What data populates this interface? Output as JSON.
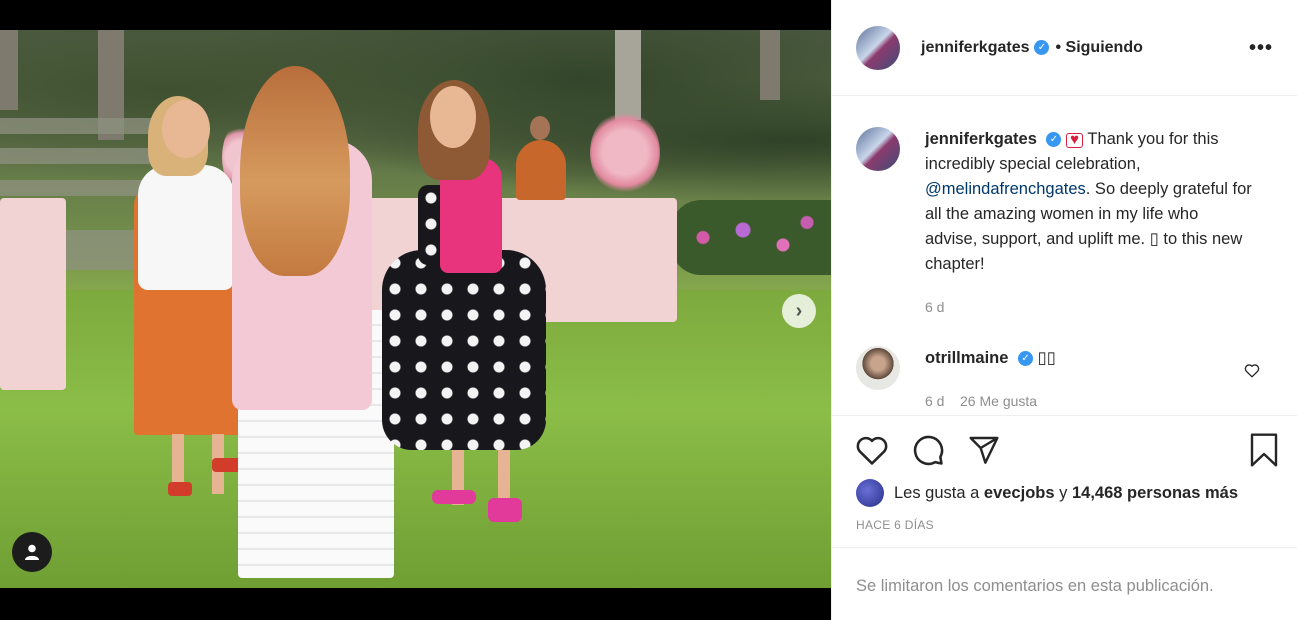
{
  "post": {
    "author": "jenniferkgates",
    "follow_status": "• Siguiendo",
    "more_label": "•••",
    "verified_mark": "✓"
  },
  "caption": {
    "user": "jenniferkgates",
    "text_before": " Thank you for this incredibly special celebration, ",
    "mention": "@melindafrenchgates",
    "text_after": ". So deeply grateful for all the amazing women in my life who advise, support, and uplift me. ▯ to this new chapter!",
    "time": "6 d"
  },
  "comment": {
    "user": "otrillmaine",
    "text": "▯▯",
    "meta": "6 d    26 Me gusta"
  },
  "likes": {
    "prefix": "Les gusta a ",
    "user": "evecjobs",
    "middle": " y ",
    "count": "14,468 personas más"
  },
  "date": "HACE 6 DÍAS",
  "comments_limited": "Se limitaron los comentarios en esta publicación.",
  "carousel": {
    "total": 4,
    "active": 0
  },
  "icons": [
    "heart-icon",
    "comment-icon",
    "share-icon",
    "bookmark-icon",
    "chevron-right-icon",
    "user-tag-icon"
  ]
}
